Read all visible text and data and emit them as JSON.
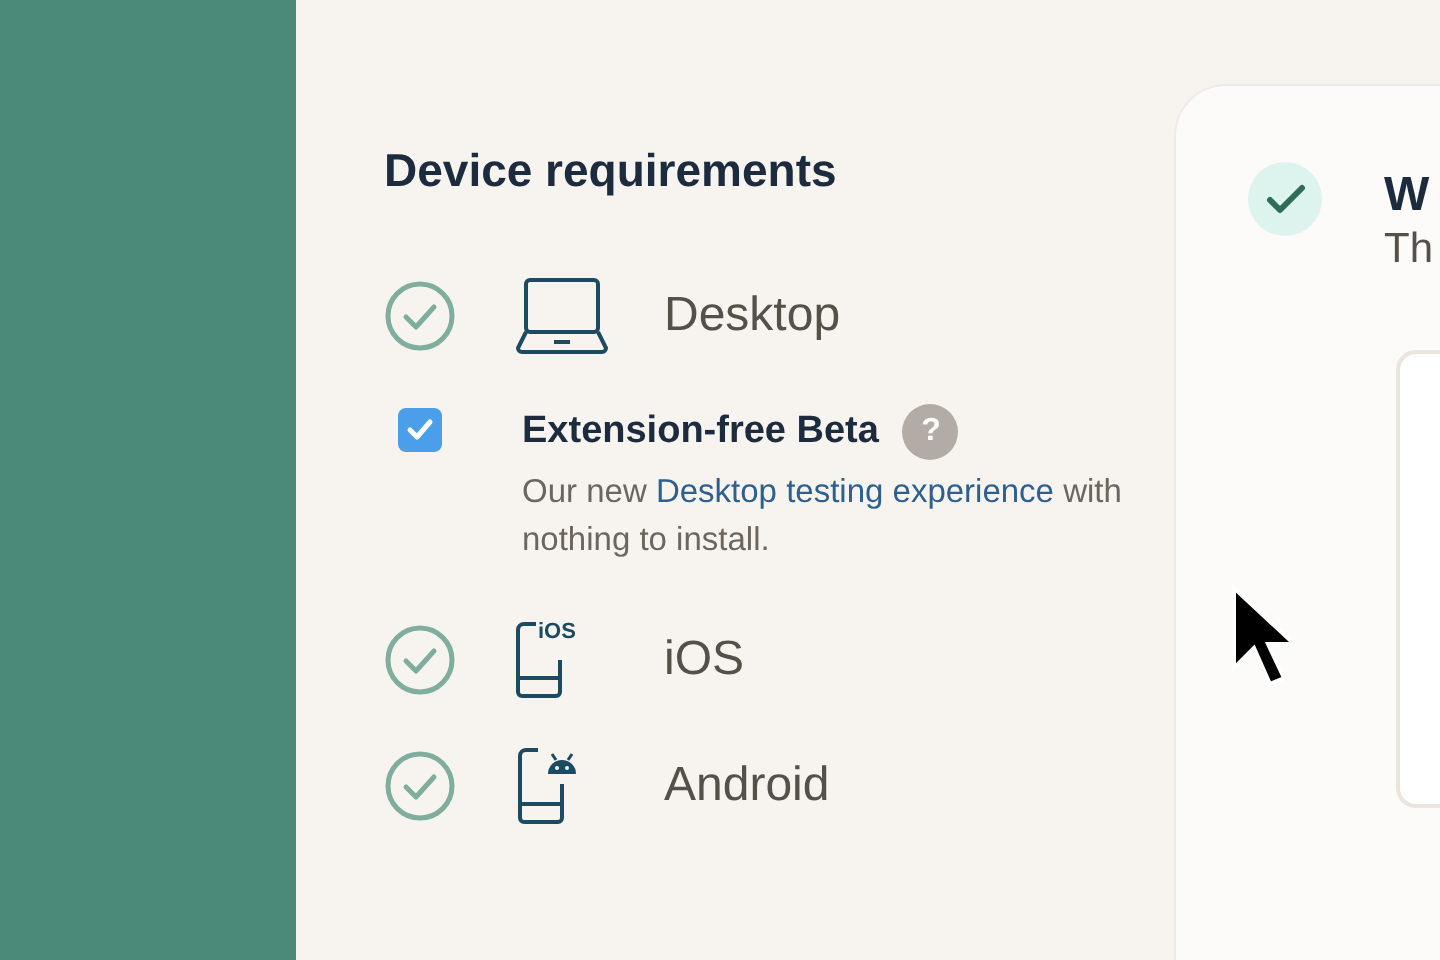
{
  "section": {
    "title": "Device requirements"
  },
  "requirements": [
    {
      "kind": "device",
      "label": "Desktop",
      "checked": true
    },
    {
      "kind": "option",
      "title": "Extension-free Beta",
      "help": "?",
      "checked": true,
      "text_before": "Our new ",
      "link": "Desktop testing experience",
      "text_after": " with nothing to install."
    },
    {
      "kind": "device",
      "icon_text": "iOS",
      "label": "iOS",
      "checked": true
    },
    {
      "kind": "device",
      "label": "Android",
      "checked": true
    }
  ],
  "card": {
    "completed": true,
    "title": "W",
    "subtitle": "Th"
  }
}
